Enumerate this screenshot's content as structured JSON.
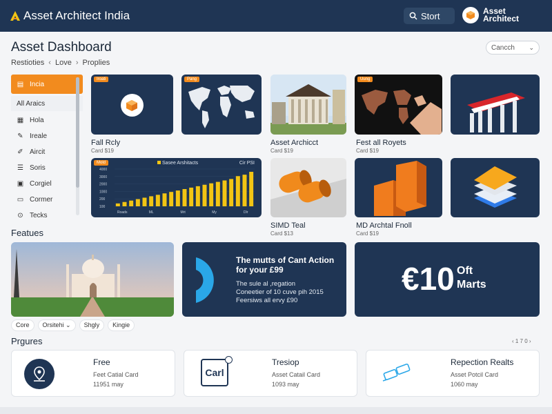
{
  "header": {
    "brand": "Asset Architect India",
    "search_label": "Stort",
    "profile_line1": "Asset",
    "profile_line2": "Architect"
  },
  "page": {
    "title": "Asset Dashboard",
    "breadcrumb": [
      "Restioties",
      "Love",
      "Proplies"
    ],
    "select_value": "Cancch"
  },
  "sidebar": {
    "items": [
      {
        "label": "Incia",
        "icon": "building-icon"
      },
      {
        "label": "All Araics",
        "icon": ""
      },
      {
        "label": "Hola",
        "icon": "grid-icon"
      },
      {
        "label": "Ireale",
        "icon": "wrench-icon"
      },
      {
        "label": "Aircit",
        "icon": "edit-icon"
      },
      {
        "label": "Soris",
        "icon": "list-icon"
      },
      {
        "label": "Corgiel",
        "icon": "calendar-icon"
      },
      {
        "label": "Cormer",
        "icon": "chat-icon"
      },
      {
        "label": "Tecks",
        "icon": "settings-icon"
      }
    ]
  },
  "cards": {
    "c1": {
      "tag": "Iroati",
      "title": "Fall Rcly",
      "sub": "Card $19"
    },
    "c2": {
      "tag": "Pang"
    },
    "c3": {
      "title": "Asset Archicct",
      "sub": "Card $19"
    },
    "c4": {
      "tag": "Uung",
      "title": "Fest all Royets",
      "sub": "Card $19"
    },
    "chart": {
      "tag": "Mold",
      "legend": "Sasee Arshitacts",
      "right_label": "Cir PSI"
    },
    "c6": {
      "title": "SIMD Teal",
      "sub": "Card $13"
    },
    "c7": {
      "title": "MD Archtal Fnoll",
      "sub": "Card $19"
    }
  },
  "chart_data": {
    "type": "bar",
    "y_ticks": [
      "4000",
      "3000",
      "2000",
      "1000",
      "200",
      "100"
    ],
    "x_ticks": [
      "Roads",
      "ML",
      "Mrt",
      "My",
      "Dlr"
    ],
    "values": [
      2,
      3,
      4,
      5,
      6,
      7,
      8,
      9,
      10,
      11,
      12,
      13,
      14,
      15,
      16,
      17,
      18,
      19,
      21,
      22,
      24
    ],
    "color": "#f2c514"
  },
  "features": {
    "title": "Featues",
    "promo_heading1": "The mutts of Cant Action",
    "promo_heading2": "for your £99",
    "promo_line1": "The sule al ,regation",
    "promo_line2": "Coneetier of 10 cuve pih 2015",
    "promo_line3": "Feersiws all ervy £90",
    "offer_number": "€10",
    "offer_line1": "Oft",
    "offer_line2": "Marts",
    "chips": [
      "Core",
      "Orsitehi",
      "Shgly",
      "Kingie"
    ],
    "chip_dropdown_index": 1
  },
  "programs": {
    "title": "Prgures",
    "pager": "‹ 1 7 0 ›",
    "cards": [
      {
        "title": "Free",
        "line1": "Feet Catial Card",
        "line2": "11951 may"
      },
      {
        "title": "Tresiop",
        "icon_text": "Carl",
        "line1": "Asset Catail Card",
        "line2": "1093 may"
      },
      {
        "title": "Repection Realts",
        "line1": "Asset Potcil Card",
        "line2": "1060 may"
      }
    ]
  },
  "colors": {
    "navy": "#1f3554",
    "orange": "#f28b1e",
    "yellow": "#f2c514",
    "blue_accent": "#2aa7e8"
  }
}
